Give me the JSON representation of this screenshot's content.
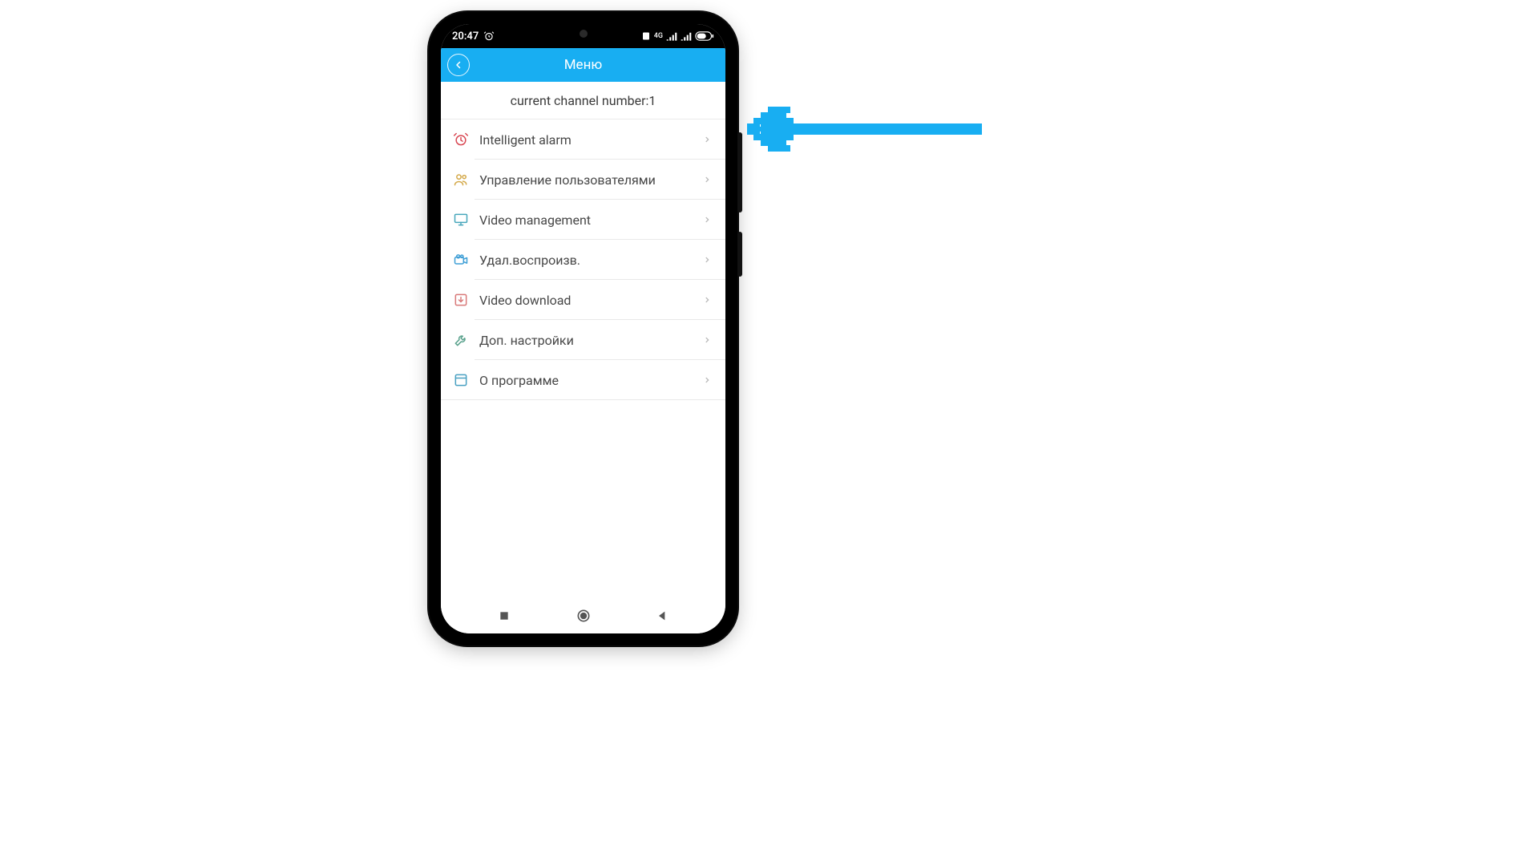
{
  "statusbar": {
    "time": "20:47",
    "network_label": "4G"
  },
  "header": {
    "title": "Меню"
  },
  "channel_info": "current channel number:1",
  "menu": {
    "items": [
      {
        "id": "intelligent-alarm",
        "label": "Intelligent alarm",
        "icon": "alarm-clock-icon",
        "icon_color": "#d94a55"
      },
      {
        "id": "user-management",
        "label": "Управление пользователями",
        "icon": "users-icon",
        "icon_color": "#d4a94a"
      },
      {
        "id": "video-management",
        "label": "Video management",
        "icon": "monitor-icon",
        "icon_color": "#48a7bc"
      },
      {
        "id": "remote-playback",
        "label": "Удал.воспроизв.",
        "icon": "video-camera-icon",
        "icon_color": "#3f9fd6"
      },
      {
        "id": "video-download",
        "label": "Video download",
        "icon": "download-icon",
        "icon_color": "#d97a7a"
      },
      {
        "id": "advanced-settings",
        "label": "Доп. настройки",
        "icon": "wrench-icon",
        "icon_color": "#5aa28d"
      },
      {
        "id": "about",
        "label": "О программе",
        "icon": "window-icon",
        "icon_color": "#4aa1c2"
      }
    ]
  },
  "annotation": {
    "arrow_color": "#18aef2"
  }
}
